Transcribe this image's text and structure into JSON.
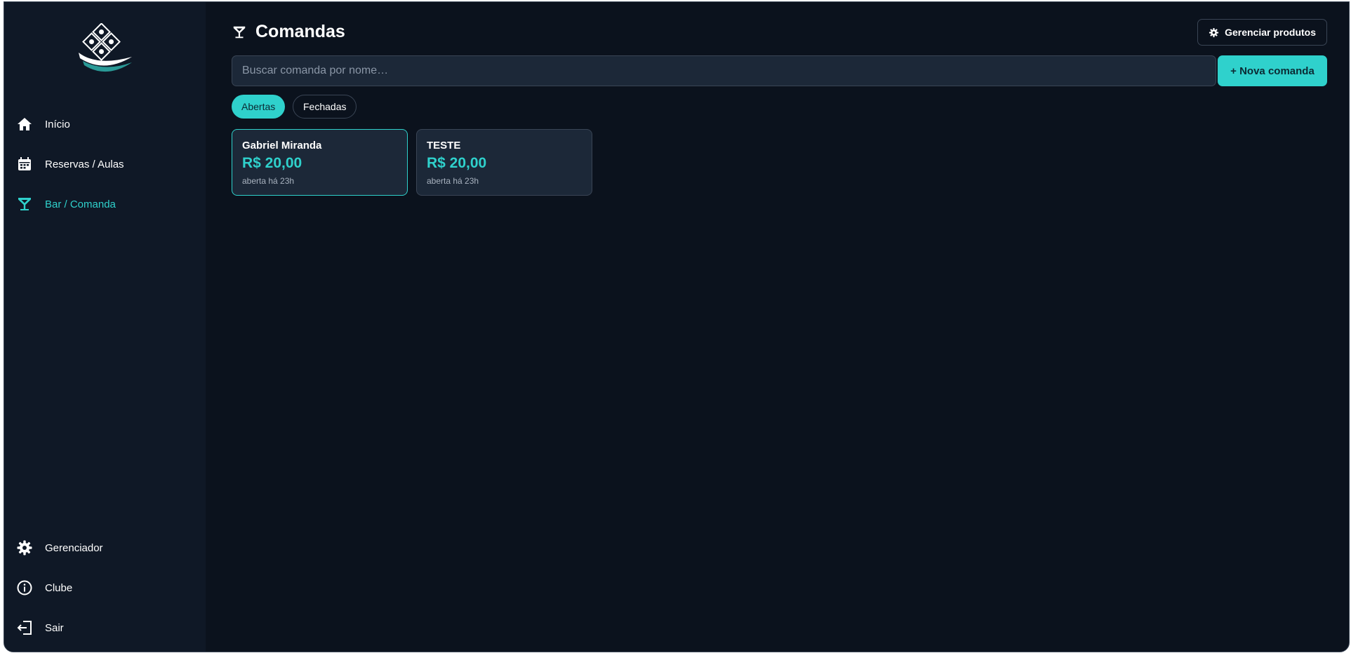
{
  "sidebar": {
    "nav_top": [
      {
        "label": "Início",
        "icon": "home-icon",
        "active": false
      },
      {
        "label": "Reservas / Aulas",
        "icon": "calendar-icon",
        "active": false
      },
      {
        "label": "Bar / Comanda",
        "icon": "cocktail-icon",
        "active": true
      }
    ],
    "nav_bottom": [
      {
        "label": "Gerenciador",
        "icon": "gear-icon"
      },
      {
        "label": "Clube",
        "icon": "info-icon"
      },
      {
        "label": "Sair",
        "icon": "logout-icon"
      }
    ]
  },
  "header": {
    "title": "Comandas",
    "manage_label": "Gerenciar produtos"
  },
  "search": {
    "placeholder": "Buscar comanda por nome…",
    "value": ""
  },
  "new_label": "+ Nova comanda",
  "filters": [
    {
      "label": "Abertas",
      "active": true
    },
    {
      "label": "Fechadas",
      "active": false
    }
  ],
  "tabs_cards": [
    {
      "name": "Gabriel Miranda",
      "amount": "R$ 20,00",
      "status": "aberta há 23h",
      "selected": true
    },
    {
      "name": "TESTE",
      "amount": "R$ 20,00",
      "status": "aberta há 23h",
      "selected": false
    }
  ],
  "colors": {
    "accent": "#2fd1cc",
    "background": "#0b121d",
    "sidebar": "#0f1826",
    "card": "#1c2838"
  }
}
